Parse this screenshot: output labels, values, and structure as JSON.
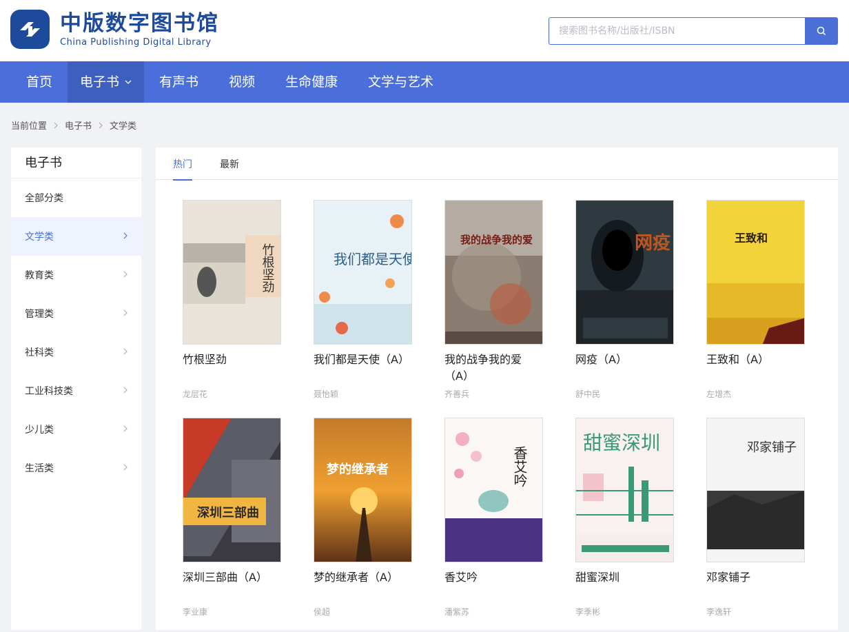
{
  "header": {
    "logo_cn": "中版数字图书馆",
    "logo_en": "China Publishing Digital Library",
    "search_placeholder": "搜索图书名称/出版社/ISBN",
    "brand_color": "#1e4a9c"
  },
  "nav": {
    "items": [
      "首页",
      "电子书",
      "有声书",
      "视频",
      "生命健康",
      "文学与艺术"
    ],
    "active_index": 1,
    "color": "#4b6fda"
  },
  "breadcrumb": [
    "当前位置",
    "电子书",
    "文学类"
  ],
  "sidebar": {
    "title": "电子书",
    "items": [
      "全部分类",
      "文学类",
      "教育类",
      "管理类",
      "社科类",
      "工业科技类",
      "少儿类",
      "生活类"
    ],
    "active_index": 1
  },
  "tabs": {
    "items": [
      "热门",
      "最新"
    ],
    "active_index": 0
  },
  "books": [
    {
      "title": "竹根坚劲",
      "author": "龙层花",
      "cover_text": "竹根坚劲"
    },
    {
      "title": "我们都是天使（A）",
      "author": "聂怡颖",
      "cover_text": "我们都是天使"
    },
    {
      "title": "我的战争我的爱（A）",
      "author": "齐善兵",
      "cover_text": "我的战争我的爱"
    },
    {
      "title": "网疫（A）",
      "author": "舒中民",
      "cover_text": "网疫"
    },
    {
      "title": "王致和（A）",
      "author": "左增杰",
      "cover_text": "王致和"
    },
    {
      "title": "深圳三部曲（A）",
      "author": "李业康",
      "cover_text": "深圳三部曲"
    },
    {
      "title": "梦的继承者（A）",
      "author": "侯超",
      "cover_text": "梦的继承者"
    },
    {
      "title": "香艾吟",
      "author": "潘紫苏",
      "cover_text": "香艾吟"
    },
    {
      "title": "甜蜜深圳",
      "author": "李季彬",
      "cover_text": "甜蜜深圳"
    },
    {
      "title": "邓家铺子",
      "author": "李逸轩",
      "cover_text": "邓家铺子"
    }
  ]
}
